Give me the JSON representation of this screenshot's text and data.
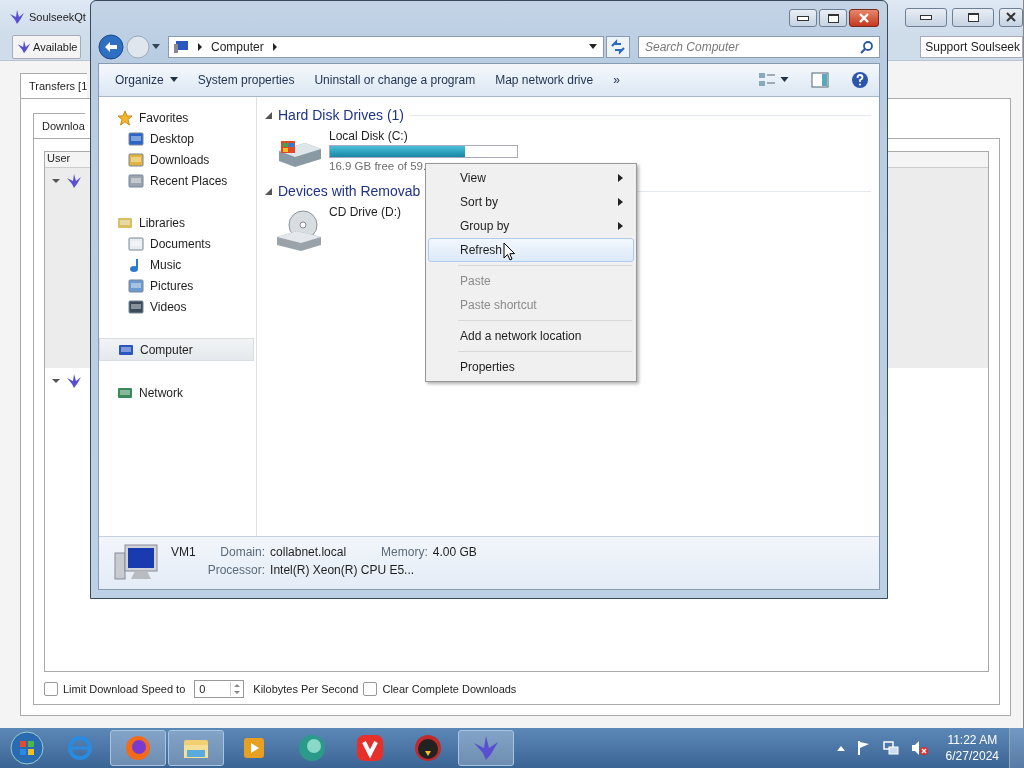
{
  "background_window": {
    "title": "SoulseekQt",
    "status_button": "Available",
    "support_field": "Support Soulseek",
    "tab": "Transfers [1",
    "subtab": "Downloa",
    "column": "User",
    "rows": [
      {
        "expanded": true,
        "selected": true
      },
      {
        "expanded": true,
        "selected": false
      }
    ],
    "footer": {
      "limit_checkbox": {
        "label": "Limit Download Speed to",
        "checked": false
      },
      "speed_value": "0",
      "speed_unit": "Kilobytes Per Second",
      "clear_checkbox": {
        "label": "Clear Complete Downloads",
        "checked": false
      }
    }
  },
  "explorer": {
    "breadcrumb": "Computer",
    "search": {
      "placeholder": "Search Computer"
    },
    "commands": [
      "Organize",
      "System properties",
      "Uninstall or change a program",
      "Map network drive",
      "»"
    ],
    "nav": [
      {
        "label": "Favorites",
        "kind": "star",
        "selected": false,
        "children": [
          {
            "label": "Desktop",
            "kind": "desktop",
            "selected": false
          },
          {
            "label": "Downloads",
            "kind": "download",
            "selected": false
          },
          {
            "label": "Recent Places",
            "kind": "recent",
            "selected": false
          }
        ]
      },
      {
        "label": "Libraries",
        "kind": "library",
        "selected": false,
        "children": [
          {
            "label": "Documents",
            "kind": "document",
            "selected": false
          },
          {
            "label": "Music",
            "kind": "music",
            "selected": false
          },
          {
            "label": "Pictures",
            "kind": "picture",
            "selected": false
          },
          {
            "label": "Videos",
            "kind": "video",
            "selected": false
          }
        ]
      },
      {
        "label": "Computer",
        "kind": "computer",
        "selected": true
      },
      {
        "label": "Network",
        "kind": "network",
        "selected": false
      }
    ],
    "groups": [
      {
        "title": "Hard Disk Drives (1)",
        "drives": [
          {
            "kind": "disk",
            "name": "Local Disk (C:)",
            "level": 0.72,
            "free": "16.9 GB free of 59."
          }
        ]
      },
      {
        "title": "Devices with Removab",
        "drives": [
          {
            "kind": "cd",
            "name": "CD Drive (D:)"
          }
        ]
      }
    ],
    "details": {
      "name": "VM1",
      "domain_label": "Domain:",
      "domain": "collabnet.local",
      "memory_label": "Memory:",
      "memory": "4.00 GB",
      "processor_label": "Processor:",
      "processor": "Intel(R) Xeon(R) CPU E5..."
    }
  },
  "context_menu": [
    {
      "kind": "item",
      "label": "View",
      "submenu": true,
      "disabled": false,
      "selected": false
    },
    {
      "kind": "item",
      "label": "Sort by",
      "submenu": true,
      "disabled": false,
      "selected": false
    },
    {
      "kind": "item",
      "label": "Group by",
      "submenu": true,
      "disabled": false,
      "selected": false
    },
    {
      "kind": "item",
      "label": "Refresh",
      "submenu": false,
      "disabled": false,
      "selected": true
    },
    {
      "kind": "separator"
    },
    {
      "kind": "item",
      "label": "Paste",
      "submenu": false,
      "disabled": true,
      "selected": false
    },
    {
      "kind": "item",
      "label": "Paste shortcut",
      "submenu": false,
      "disabled": true,
      "selected": false
    },
    {
      "kind": "separator"
    },
    {
      "kind": "item",
      "label": "Add a network location",
      "submenu": false,
      "disabled": false,
      "selected": false
    },
    {
      "kind": "separator"
    },
    {
      "kind": "item",
      "label": "Properties",
      "submenu": false,
      "disabled": false,
      "selected": false
    }
  ],
  "taskbar": {
    "apps": [
      {
        "kind": "globe",
        "running": false
      },
      {
        "kind": "fox",
        "running": true
      },
      {
        "kind": "folder",
        "running": true
      },
      {
        "kind": "play",
        "running": false
      },
      {
        "kind": "sphere",
        "running": false
      },
      {
        "kind": "chevron",
        "running": false
      },
      {
        "kind": "birdface",
        "running": false
      },
      {
        "kind": "bird",
        "running": true
      }
    ],
    "time": "11:22 AM",
    "date": "6/27/2024"
  }
}
